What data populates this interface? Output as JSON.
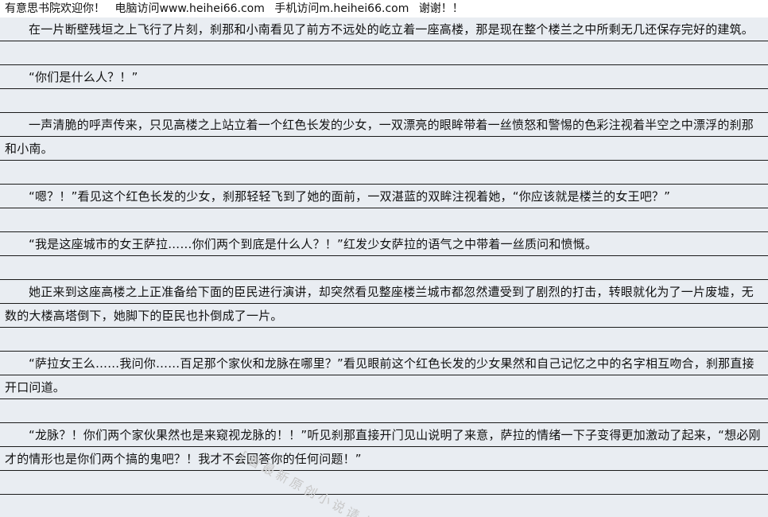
{
  "header": {
    "notice": "有意思书院欢迎你！",
    "pc": "电脑访问www.heihei66.com",
    "mobile": "手机访问m.heihei66.com",
    "thanks": "谢谢！！"
  },
  "paragraphs": [
    "在一片断壁残垣之上飞行了片刻，刹那和小南看见了前方不远处的屹立着一座高楼，那是现在整个楼兰之中所剩无几还保存完好的建筑。",
    "“你们是什么人？！”",
    "一声清脆的呼声传来，只见高楼之上站立着一个红色长发的少女，一双漂亮的眼眸带着一丝愤怒和警惕的色彩注视着半空之中漂浮的刹那和小南。",
    "“嗯？！”看见这个红色长发的少女，刹那轻轻飞到了她的面前，一双湛蓝的双眸注视着她，“你应该就是楼兰的女王吧？”",
    "“我是这座城市的女王萨拉……你们两个到底是什么人？！”红发少女萨拉的语气之中带着一丝质问和愤慨。",
    "她正来到这座高楼之上正准备给下面的臣民进行演讲，却突然看见整座楼兰城市都忽然遭受到了剧烈的打击，转眼就化为了一片废墟，无数的大楼高塔倒下，她脚下的臣民也扑倒成了一片。",
    "“萨拉女王么……我问你……百足那个家伙和龙脉在哪里？”看见眼前这个红色长发的少女果然和自己记忆之中的名字相互吻合，刹那直接开口问道。",
    "“龙脉？！你们两个家伙果然也是来窥视龙脉的！！”听见刹那直接开门见山说明了来意，萨拉的情绪一下子变得更加激动了起来，“想必刚才的情形也是你们两个搞的鬼吧？！我才不会回答你的任何问题！”"
  ],
  "watermark": "[看最新原创小说请上"
}
